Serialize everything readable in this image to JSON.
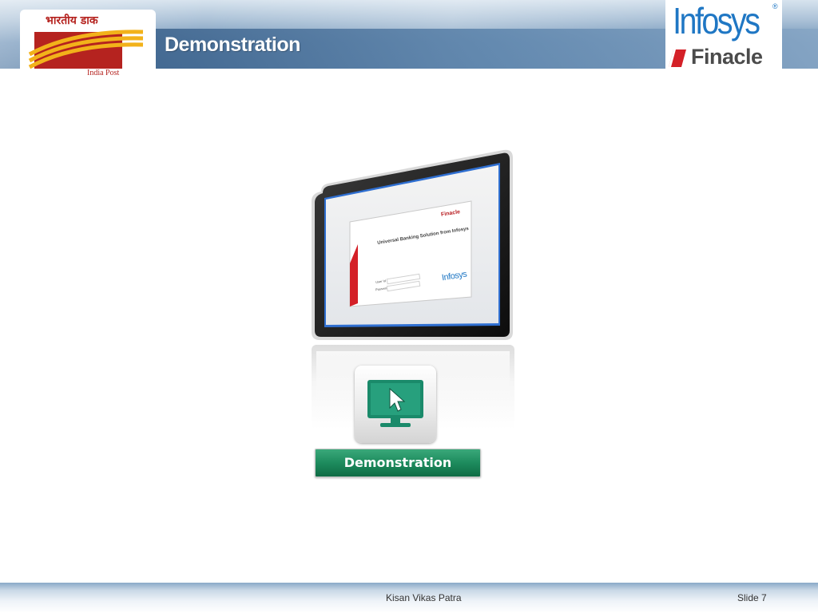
{
  "header": {
    "title": "Demonstration",
    "india_post": {
      "hindi_text": "भारतीय डाक",
      "label": "India Post"
    },
    "infosys": {
      "brand": "Infosys",
      "registered": "®",
      "product": "Finacle"
    }
  },
  "illustration": {
    "screen": {
      "brand": "Finacle",
      "heading": "Universal Banking Solution from Infosys",
      "user_label": "User Id",
      "password_label": "Password",
      "logo": "Infosys"
    },
    "demo_icon": "monitor-cursor-icon",
    "demo_button_label": "Demonstration"
  },
  "footer": {
    "center_text": "Kisan Vikas Patra",
    "slide_label": "Slide 7"
  },
  "colors": {
    "india_post_red": "#b5231f",
    "india_post_yellow": "#f2b21a",
    "infosys_blue": "#1f77c4",
    "demo_green": "#1d8b5d"
  }
}
